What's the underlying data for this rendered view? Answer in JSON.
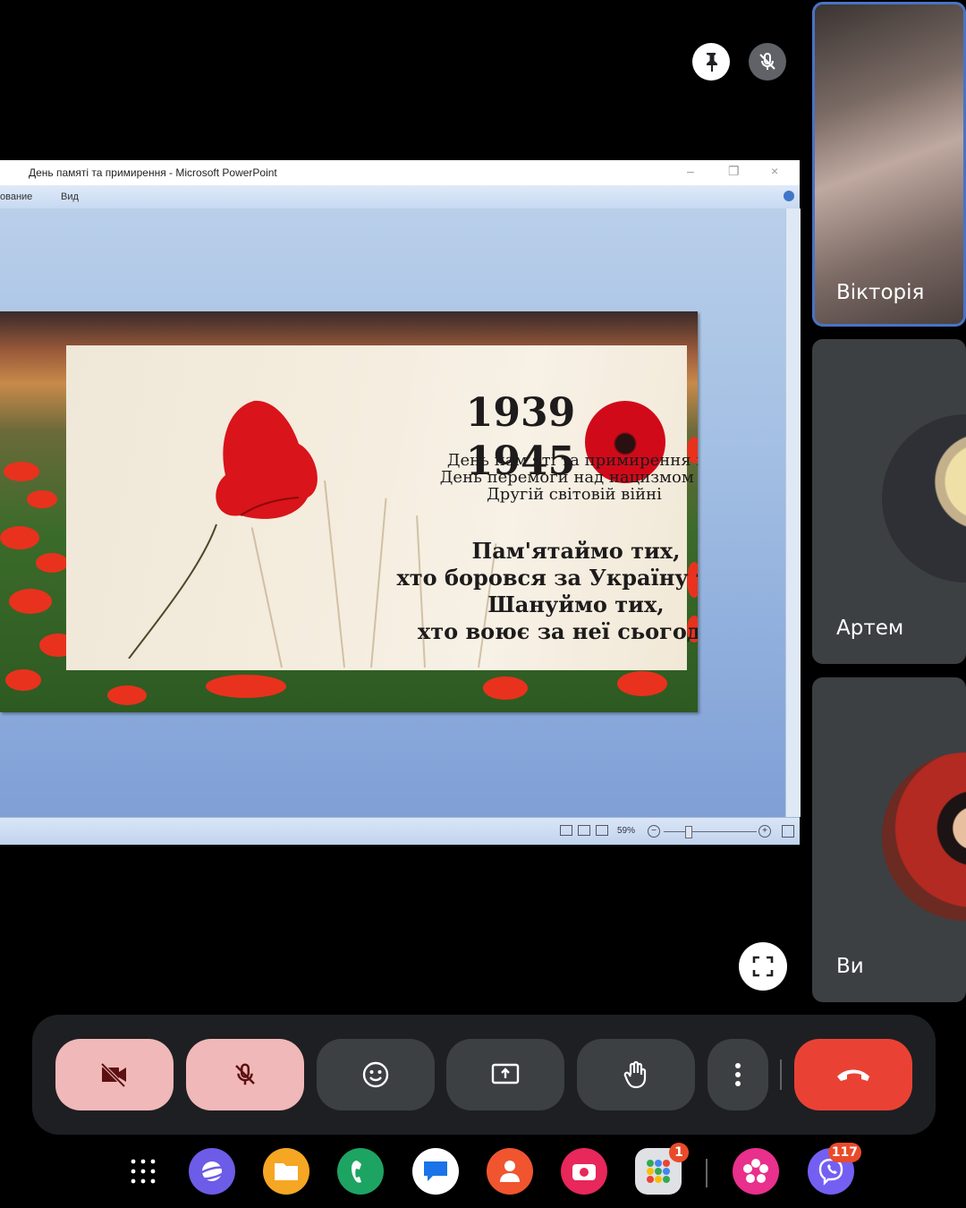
{
  "presentation": {
    "window_title": "День памяті та примирення - Microsoft PowerPoint",
    "menu": [
      "ованиe",
      "Вид"
    ],
    "zoom": "59%",
    "slide": {
      "year_start": "1939",
      "year_end": "1945",
      "subtitle_lines": [
        "День пам'яті та примирення і",
        "День перемоги над нацизмом у",
        "Другій світовій війні"
      ],
      "quote_lines": [
        "Пам'ятаймо тих,",
        "хто боровся за Україну тоді!",
        "Шануймо тих,",
        "хто воює за неї сьогодні!"
      ]
    }
  },
  "participants": [
    {
      "name": "Вікторія"
    },
    {
      "name": "Артем"
    },
    {
      "name": "Ви"
    }
  ],
  "dock": {
    "gallery_badge": "1",
    "viber_badge": "117"
  },
  "colors": {
    "muted_button": "#f0b8b8",
    "hangup": "#e94235",
    "control_bg": "#3c4043",
    "active_tile_border": "#4a73c4"
  }
}
